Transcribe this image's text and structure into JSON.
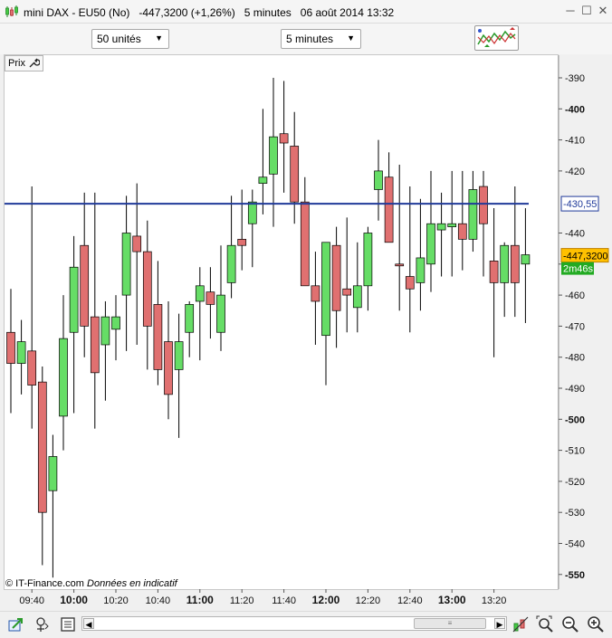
{
  "window": {
    "instrument": "mini DAX - EU50 (No)",
    "price_change": "-447,3200 (+1,26%)",
    "timeframe": "5 minutes",
    "datetime": "06 août 2014 13:32",
    "minimize_glyph": "─",
    "maximize_glyph": "☐",
    "close_glyph": "✕"
  },
  "toolbar": {
    "units_select": "50 unités",
    "timeframe_select": "5 minutes",
    "caret": "▼"
  },
  "chart_panel": {
    "label": "Prix",
    "copyright": "© IT-Finance.com",
    "disclaimer": "Données en indicatif"
  },
  "colors": {
    "up_candle": "#66dd66",
    "down_candle": "#e07070",
    "wick": "#000000",
    "horizontal_line": "#203a9a",
    "last_price_box": "#ffc000",
    "countdown_box": "#22aa22"
  },
  "scroll": {
    "left_arrow": "◀",
    "right_arrow": "▶",
    "thumb_grip": "≡"
  },
  "bottom_icons": [
    "zoom-fit-icon",
    "cursor-mode-icon",
    "settings-icon",
    "draw-tool-icon",
    "zoom-region-icon",
    "zoom-out-icon",
    "zoom-in-icon"
  ],
  "chart_data": {
    "type": "candlestick",
    "ylim": [
      -555,
      -382
    ],
    "yticks": [
      -390,
      -400,
      -410,
      -420,
      -440,
      -450,
      -460,
      -470,
      -480,
      -490,
      -500,
      -510,
      -520,
      -530,
      -540,
      -550
    ],
    "ytick_labels": [
      "-390",
      "-400",
      "-410",
      "-420",
      "-440",
      "-450",
      "-460",
      "-470",
      "-480",
      "-490",
      "-500",
      "-510",
      "-520",
      "-530",
      "-540",
      "-550"
    ],
    "major_yticks": [
      "-400",
      "-450",
      "-500",
      "-550"
    ],
    "xticks": [
      {
        "label": "09:40",
        "index": 2,
        "major": false
      },
      {
        "label": "10:00",
        "index": 6,
        "major": true
      },
      {
        "label": "10:20",
        "index": 10,
        "major": false
      },
      {
        "label": "10:40",
        "index": 14,
        "major": false
      },
      {
        "label": "11:00",
        "index": 18,
        "major": true
      },
      {
        "label": "11:20",
        "index": 22,
        "major": false
      },
      {
        "label": "11:40",
        "index": 26,
        "major": false
      },
      {
        "label": "12:00",
        "index": 30,
        "major": true
      },
      {
        "label": "12:20",
        "index": 34,
        "major": false
      },
      {
        "label": "12:40",
        "index": 38,
        "major": false
      },
      {
        "label": "13:00",
        "index": 42,
        "major": true
      },
      {
        "label": "13:20",
        "index": 46,
        "major": false
      }
    ],
    "candles": [
      {
        "o": -472,
        "h": -458,
        "l": -498,
        "c": -482
      },
      {
        "o": -482,
        "h": -468,
        "l": -492,
        "c": -475
      },
      {
        "o": -478,
        "h": -425,
        "l": -503,
        "c": -489
      },
      {
        "o": -488,
        "h": -483,
        "l": -547,
        "c": -530
      },
      {
        "o": -523,
        "h": -505,
        "l": -551,
        "c": -512
      },
      {
        "o": -499,
        "h": -460,
        "l": -510,
        "c": -474
      },
      {
        "o": -472,
        "h": -441,
        "l": -498,
        "c": -451
      },
      {
        "o": -444,
        "h": -427,
        "l": -480,
        "c": -470
      },
      {
        "o": -467,
        "h": -427,
        "l": -503,
        "c": -485
      },
      {
        "o": -476,
        "h": -462,
        "l": -494,
        "c": -467
      },
      {
        "o": -471,
        "h": -460,
        "l": -481,
        "c": -467
      },
      {
        "o": -460,
        "h": -428,
        "l": -478,
        "c": -440
      },
      {
        "o": -441,
        "h": -424,
        "l": -476,
        "c": -446
      },
      {
        "o": -446,
        "h": -436,
        "l": -484,
        "c": -470
      },
      {
        "o": -463,
        "h": -449,
        "l": -489,
        "c": -484
      },
      {
        "o": -475,
        "h": -462,
        "l": -500,
        "c": -492
      },
      {
        "o": -484,
        "h": -466,
        "l": -506,
        "c": -475
      },
      {
        "o": -472,
        "h": -462,
        "l": -480,
        "c": -463
      },
      {
        "o": -462,
        "h": -451,
        "l": -481,
        "c": -457
      },
      {
        "o": -459,
        "h": -451,
        "l": -474,
        "c": -463
      },
      {
        "o": -472,
        "h": -444,
        "l": -478,
        "c": -460
      },
      {
        "o": -456,
        "h": -428,
        "l": -461,
        "c": -444
      },
      {
        "o": -442,
        "h": -426,
        "l": -452,
        "c": -444
      },
      {
        "o": -437,
        "h": -426,
        "l": -451,
        "c": -430
      },
      {
        "o": -424,
        "h": -400,
        "l": -434,
        "c": -422
      },
      {
        "o": -421,
        "h": -390,
        "l": -438,
        "c": -409
      },
      {
        "o": -408,
        "h": -391,
        "l": -427,
        "c": -411
      },
      {
        "o": -412,
        "h": -401,
        "l": -437,
        "c": -430
      },
      {
        "o": -430,
        "h": -422,
        "l": -457,
        "c": -457
      },
      {
        "o": -457,
        "h": -446,
        "l": -476,
        "c": -462
      },
      {
        "o": -473,
        "h": -444,
        "l": -489,
        "c": -443
      },
      {
        "o": -444,
        "h": -438,
        "l": -477,
        "c": -465
      },
      {
        "o": -458,
        "h": -435,
        "l": -472,
        "c": -460
      },
      {
        "o": -464,
        "h": -443,
        "l": -472,
        "c": -457
      },
      {
        "o": -457,
        "h": -438,
        "l": -465,
        "c": -440
      },
      {
        "o": -426,
        "h": -410,
        "l": -436,
        "c": -420
      },
      {
        "o": -422,
        "h": -414,
        "l": -442,
        "c": -443
      },
      {
        "o": -450,
        "h": -418,
        "l": -465,
        "c": -450
      },
      {
        "o": -454,
        "h": -425,
        "l": -472,
        "c": -458
      },
      {
        "o": -456,
        "h": -429,
        "l": -465,
        "c": -448
      },
      {
        "o": -450,
        "h": -420,
        "l": -459,
        "c": -437
      },
      {
        "o": -439,
        "h": -427,
        "l": -454,
        "c": -437
      },
      {
        "o": -438,
        "h": -420,
        "l": -454,
        "c": -437
      },
      {
        "o": -437,
        "h": -420,
        "l": -452,
        "c": -442
      },
      {
        "o": -442,
        "h": -420,
        "l": -446,
        "c": -426
      },
      {
        "o": -425,
        "h": -420,
        "l": -454,
        "c": -437
      },
      {
        "o": -449,
        "h": -432,
        "l": -480,
        "c": -456
      },
      {
        "o": -456,
        "h": -443,
        "l": -467,
        "c": -444
      },
      {
        "o": -444,
        "h": -425,
        "l": -467,
        "c": -456
      },
      {
        "o": -450,
        "h": -432,
        "l": -469,
        "c": -447
      }
    ],
    "horizontal_line": {
      "value": -430.55,
      "label": "-430,55"
    },
    "last_price": {
      "value": -447.32,
      "label": "-447,3200"
    },
    "countdown": "2m46s",
    "grid": false
  }
}
